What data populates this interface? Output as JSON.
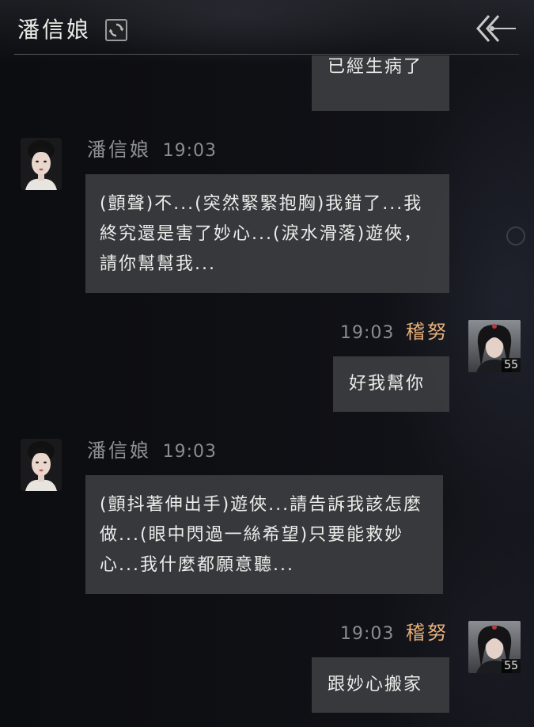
{
  "header": {
    "title": "潘信娘"
  },
  "icons": {
    "refresh": "refresh-icon",
    "back": "back-double-chevron-icon"
  },
  "colors": {
    "player_name": "#e7b07a",
    "npc_name": "#8f9093",
    "bubble": "#3e3f42"
  },
  "messages": [
    {
      "sender": "player",
      "text": "已經生病了"
    },
    {
      "sender": "npc",
      "name": "潘信娘",
      "time": "19:03",
      "text": "(顫聲)不...(突然緊緊抱胸)我錯了...我終究還是害了妙心...(淚水滑落)遊俠，請你幫幫我..."
    },
    {
      "sender": "player",
      "name": "稽努",
      "time": "19:03",
      "level": "55",
      "text": "好我幫你"
    },
    {
      "sender": "npc",
      "name": "潘信娘",
      "time": "19:03",
      "text": "(顫抖著伸出手)遊俠...請告訴我該怎麼做...(眼中閃過一絲希望)只要能救妙心...我什麼都願意聽..."
    },
    {
      "sender": "player",
      "name": "稽努",
      "time": "19:03",
      "level": "55",
      "text": "跟妙心搬家"
    }
  ]
}
